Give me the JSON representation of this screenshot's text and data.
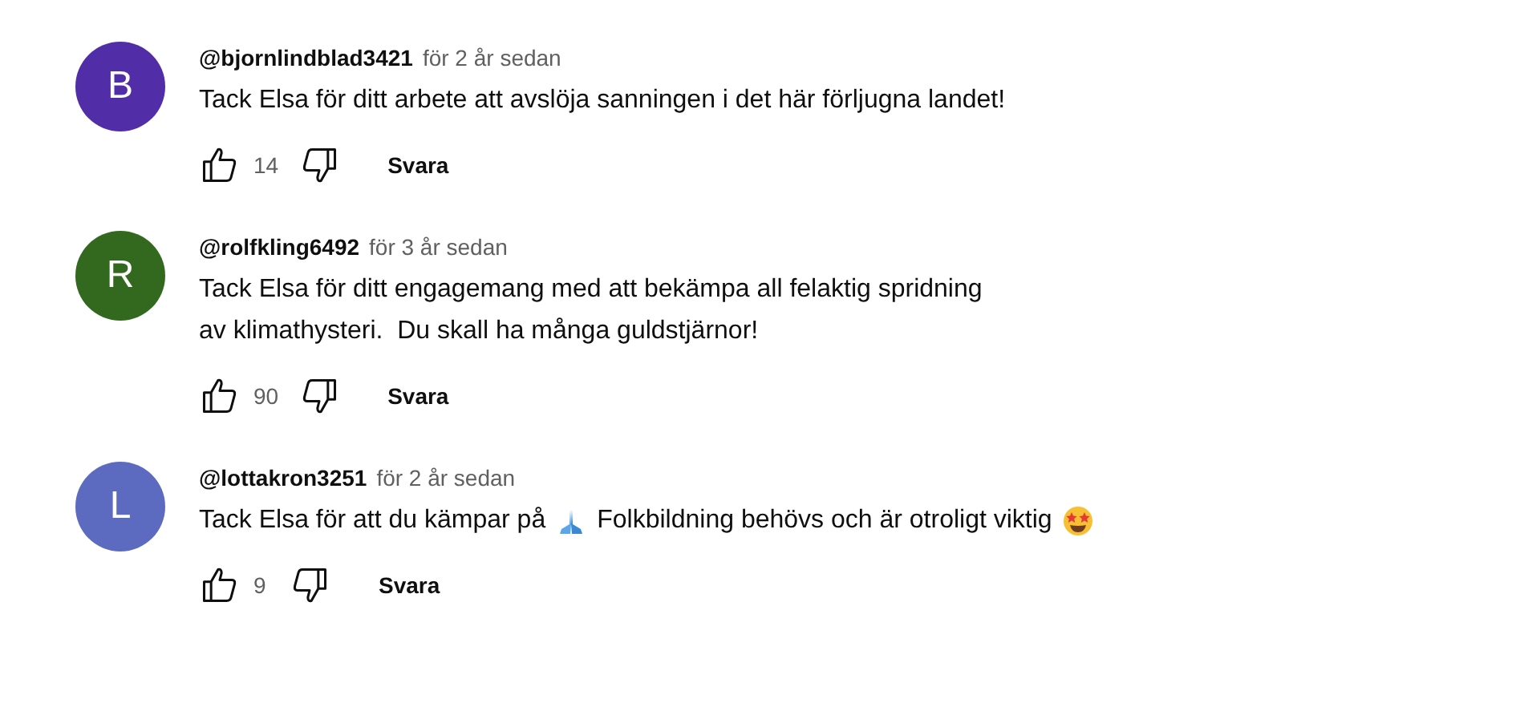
{
  "comments": [
    {
      "avatar_letter": "B",
      "color": "#512da8",
      "author": "@bjornlindblad3421",
      "time": "för 2 år sedan",
      "lines": [
        [
          {
            "kind": "text",
            "text": "Tack Elsa för ditt arbete att avslöja sanningen i det här förljugna landet!"
          }
        ]
      ],
      "likes": "14",
      "reply": "Svara"
    },
    {
      "avatar_letter": "R",
      "color": "#33691e",
      "author": "@rolfkling6492",
      "time": "för 3 år sedan",
      "lines": [
        [
          {
            "kind": "text",
            "text": "Tack Elsa för ditt engagemang med att bekämpa all felaktig spridning"
          }
        ],
        [
          {
            "kind": "text",
            "text": "av klimathysteri.  Du skall ha många guldstjärnor!"
          }
        ]
      ],
      "likes": "90",
      "reply": "Svara"
    },
    {
      "avatar_letter": "L",
      "color": "#5c6bc0",
      "author": "@lottakron3251",
      "time": "för 2 år sedan",
      "lines": [
        [
          {
            "kind": "text",
            "text": "Tack Elsa för att du kämpar på"
          },
          {
            "kind": "pray"
          },
          {
            "kind": "text",
            "text": "Folkbildning behövs och är otroligt viktig"
          },
          {
            "kind": "starstruck"
          }
        ]
      ],
      "likes": "9",
      "reply": "Svara"
    }
  ]
}
